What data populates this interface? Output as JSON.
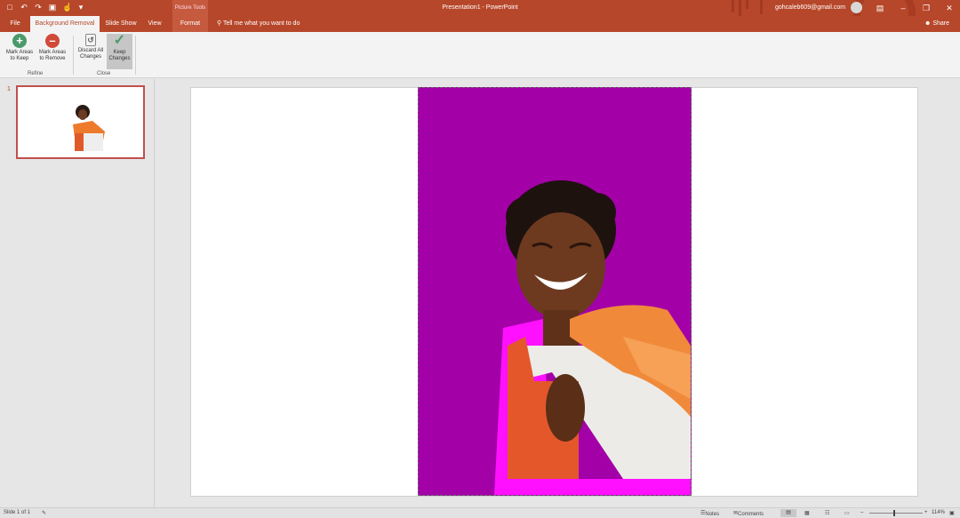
{
  "window": {
    "quick_access": [
      "save-icon",
      "undo-icon",
      "redo-icon",
      "start-from-beginning-icon",
      "touch-mode-icon",
      "customize-icon"
    ],
    "context_group": "Picture Tools",
    "title": "Presentation1  -  PowerPoint",
    "user_email": "gohcaleb609@gmail.com",
    "controls": [
      "ribbon-display-icon",
      "minimize-icon",
      "restore-icon",
      "close-icon"
    ]
  },
  "tabs": [
    {
      "label": "File"
    },
    {
      "label": "Background Removal"
    },
    {
      "label": "Slide Show"
    },
    {
      "label": "View"
    },
    {
      "label": "Format"
    }
  ],
  "tell_me": "Tell me what you want to do",
  "share": "Share",
  "ribbon": {
    "mark_keep": [
      "Mark Areas",
      "to Keep"
    ],
    "mark_remove": [
      "Mark Areas",
      "to Remove"
    ],
    "discard": [
      "Discard All",
      "Changes"
    ],
    "keep": [
      "Keep",
      "Changes"
    ],
    "group_refine": "Refine",
    "group_close": "Close"
  },
  "slides": {
    "current_number": "1"
  },
  "status": {
    "slide_info": "Slide 1 of 1",
    "notes": "Notes",
    "comments": "Comments",
    "zoom": "114%"
  },
  "colors": {
    "accent": "#b7472a",
    "removal_overlay": "#a300a8"
  }
}
